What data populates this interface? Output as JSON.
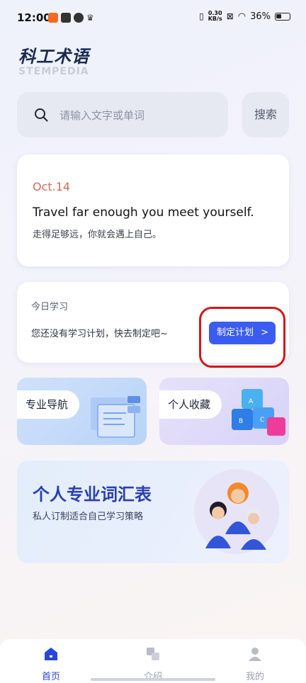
{
  "status_bar": {
    "time": "12:00",
    "net_speed_value": "0.30",
    "net_speed_unit": "KB/s",
    "battery": "36%"
  },
  "logo": {
    "title_cn": "科工术语",
    "title_en": "STEMPEDIA"
  },
  "search": {
    "placeholder": "请输入文字或单词",
    "button_label": "搜索"
  },
  "quote": {
    "date": "Oct.14",
    "english": "Travel far enough you meet yourself.",
    "chinese": "走得足够远，你就会遇上自己。"
  },
  "plan": {
    "title": "今日学习",
    "description": "您还没有学习计划，快去制定吧~",
    "button_label": "制定计划",
    "button_chevron": ">"
  },
  "nav_cards": [
    {
      "label": "专业导航"
    },
    {
      "label": "个人收藏"
    }
  ],
  "vocab": {
    "title": "个人专业词汇表",
    "subtitle": "私人订制适合自己学习策略"
  },
  "bottom_nav": {
    "tabs": [
      {
        "label": "首页",
        "icon": "home-icon",
        "active": true
      },
      {
        "label": "介绍",
        "icon": "translate-icon",
        "active": false
      },
      {
        "label": "我的",
        "icon": "user-icon",
        "active": false
      }
    ]
  },
  "colors": {
    "accent": "#3b5cf0",
    "date": "#d26a55",
    "highlight_ring": "#d4161b",
    "vocab_title": "#2a3fb0"
  }
}
